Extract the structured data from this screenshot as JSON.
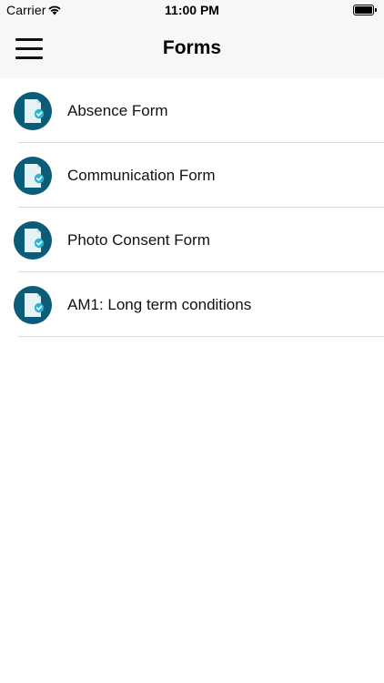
{
  "status_bar": {
    "carrier": "Carrier",
    "time": "11:00 PM"
  },
  "nav": {
    "title": "Forms",
    "menu_icon": "hamburger-menu-icon"
  },
  "forms": [
    {
      "label": "Absence Form",
      "icon": "form-document-icon"
    },
    {
      "label": "Communication Form",
      "icon": "form-document-icon"
    },
    {
      "label": "Photo Consent Form",
      "icon": "form-document-icon"
    },
    {
      "label": "AM1: Long term conditions",
      "icon": "form-document-icon"
    }
  ],
  "colors": {
    "icon_circle": "#0b5c78",
    "icon_page": "#e6f3f6",
    "icon_check": "#2bb3d6",
    "bar_background": "#f7f7f7",
    "divider": "#dcdcdc"
  }
}
